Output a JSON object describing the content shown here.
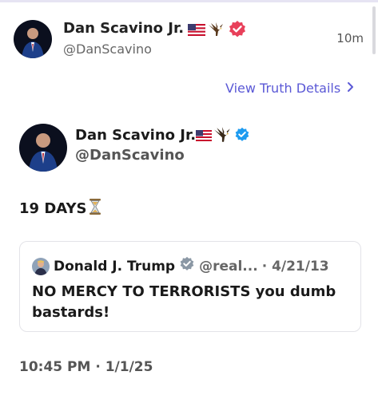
{
  "post": {
    "author_name": "Dan Scavino Jr.",
    "author_handle": "@DanScavino",
    "time_ago": "10m",
    "view_details_label": "View Truth Details"
  },
  "embed": {
    "author_name": "Dan Scavino Jr.",
    "author_handle": "@DanScavino",
    "text": "19 DAYS",
    "timestamp": "10:45 PM · 1/1/25",
    "quote": {
      "author_name": "Donald J. Trump",
      "author_handle": "@real...",
      "date": "· 4/21/13",
      "text": "NO MERCY TO TERRORISTS you dumb bastards!"
    }
  },
  "colors": {
    "accent": "#5b59d6",
    "truth_badge": "#e8405a",
    "verified_blue": "#1d9bf0"
  },
  "icons": [
    "us-flag-icon",
    "eagle-icon",
    "verified-badge-icon",
    "chevron-right-icon",
    "hourglass-icon"
  ]
}
